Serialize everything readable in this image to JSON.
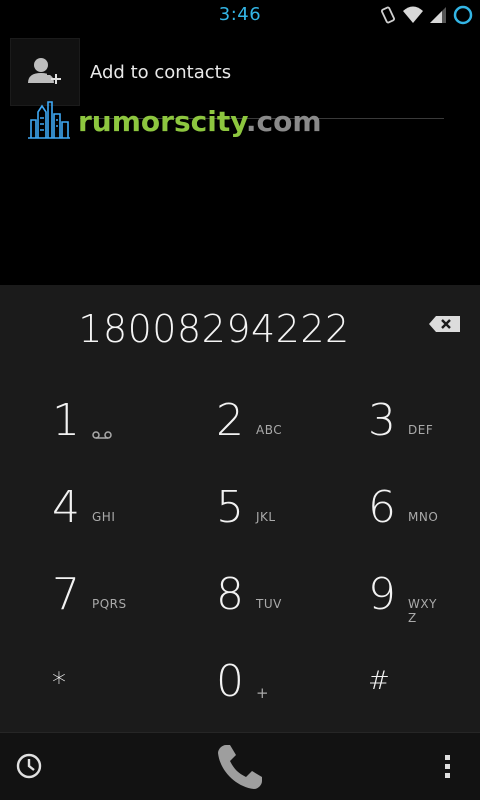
{
  "status_bar": {
    "time": "3:46",
    "icons": [
      "vibrate-icon",
      "wifi-icon",
      "signal-icon",
      "battery-ring-icon"
    ],
    "accent_color": "#33b5e5"
  },
  "contact_row": {
    "label": "Add to contacts",
    "icon": "add-contact-icon"
  },
  "watermark": {
    "text_main": "rumorscity",
    "text_suffix": ".com",
    "main_color": "#8dc63f",
    "suffix_color": "#8a8a8a",
    "icon": "city-skyline-icon"
  },
  "dial": {
    "number": "18008294222",
    "backspace_icon": "backspace-icon"
  },
  "keys": [
    {
      "digit": "1",
      "letters": "",
      "icon": "voicemail-icon"
    },
    {
      "digit": "2",
      "letters": "ABC"
    },
    {
      "digit": "3",
      "letters": "DEF"
    },
    {
      "digit": "4",
      "letters": "GHI"
    },
    {
      "digit": "5",
      "letters": "JKL"
    },
    {
      "digit": "6",
      "letters": "MNO"
    },
    {
      "digit": "7",
      "letters": "PQRS"
    },
    {
      "digit": "8",
      "letters": "TUV"
    },
    {
      "digit": "9",
      "letters": "WXYZ"
    },
    {
      "digit": "*",
      "letters": ""
    },
    {
      "digit": "0",
      "letters": "+"
    },
    {
      "digit": "#",
      "letters": ""
    }
  ],
  "bottom_bar": {
    "history_icon": "call-history-icon",
    "call_icon": "phone-icon",
    "menu_icon": "overflow-menu-icon"
  }
}
